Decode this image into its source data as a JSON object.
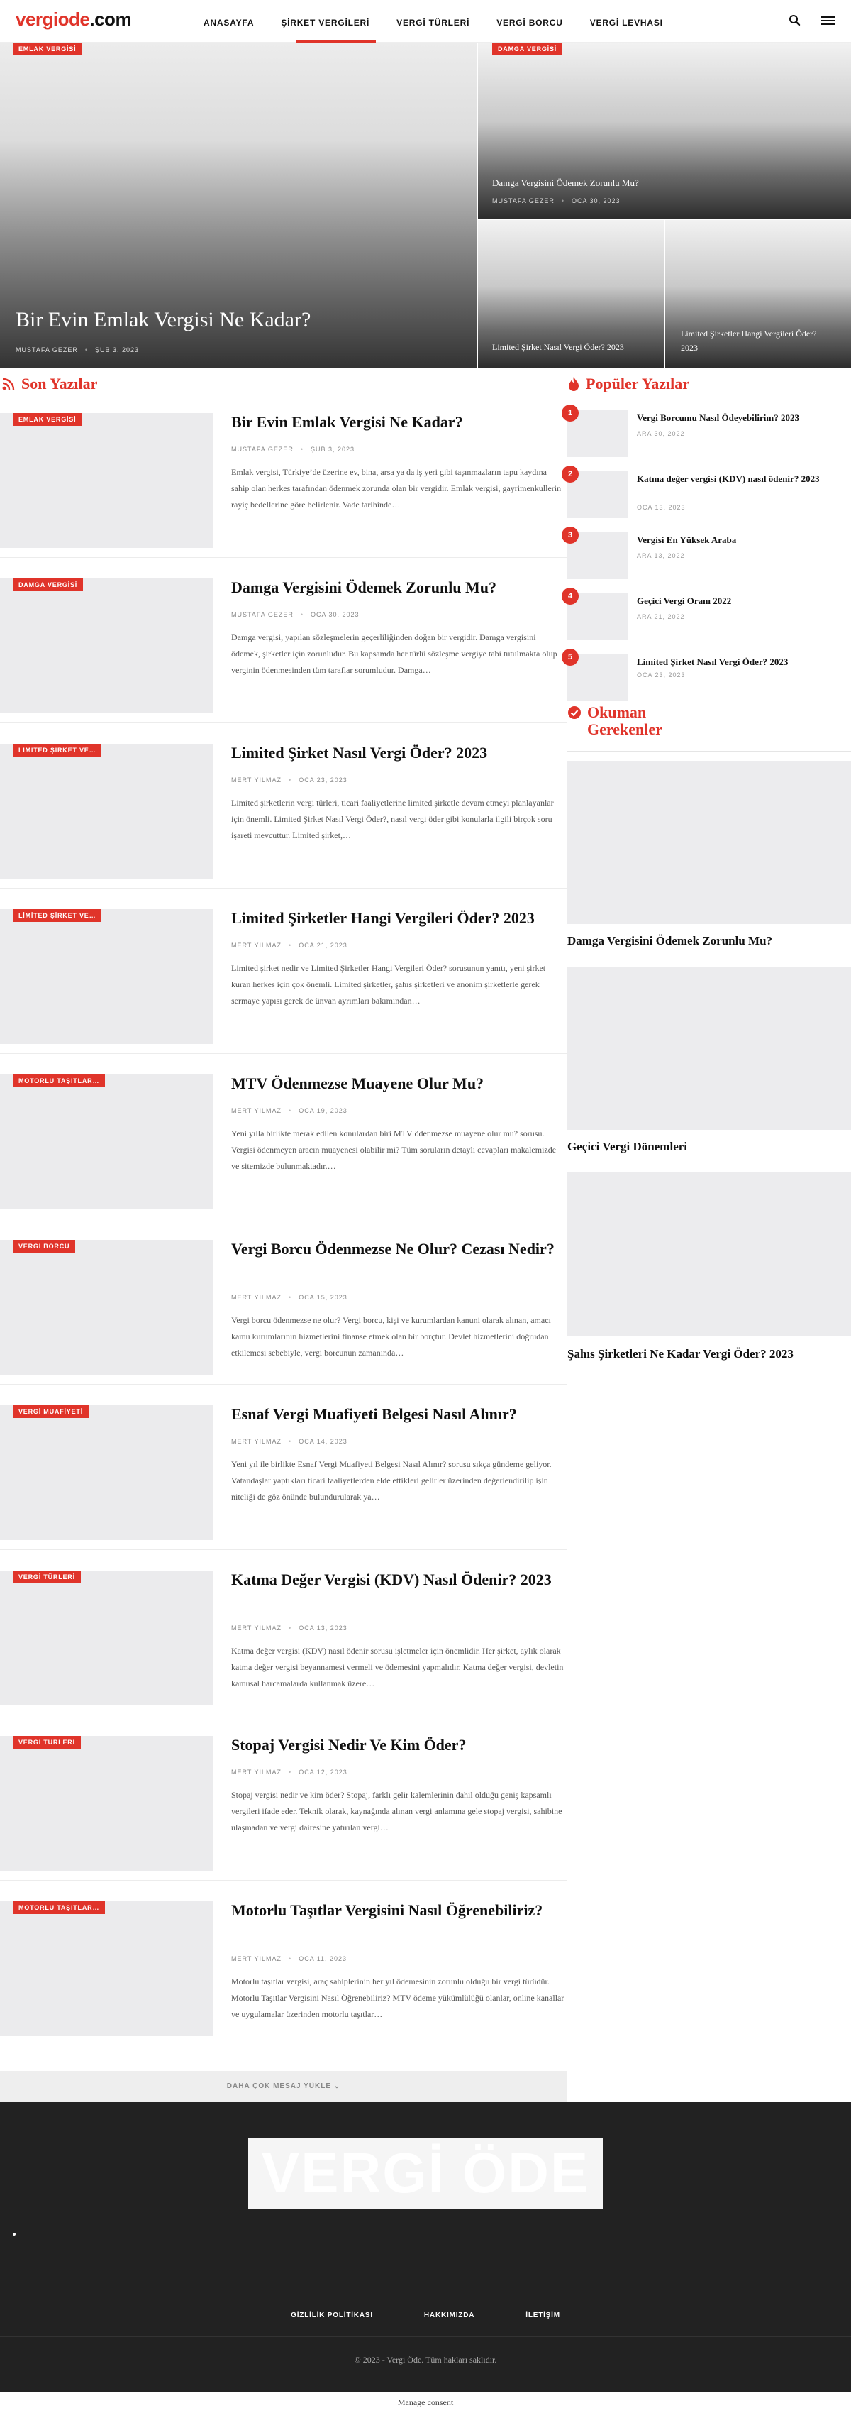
{
  "logo": {
    "part1": "vergiode",
    "part2": ".com"
  },
  "nav": [
    "ANASAYFA",
    "ŞİRKET VERGİLERİ",
    "VERGİ TÜRLERİ",
    "VERGİ BORCU",
    "VERGİ LEVHASI"
  ],
  "hero": {
    "main": {
      "category": "EMLAK VERGİSİ",
      "title": "Bir Evin Emlak Vergisi Ne Kadar?",
      "author": "MUSTAFA GEZER",
      "date": "ŞUB 3, 2023"
    },
    "top_right": {
      "category": "DAMGA VERGİSİ",
      "title": "Damga Vergisini Ödemek Zorunlu Mu?",
      "author": "MUSTAFA GEZER",
      "date": "OCA 30, 2023"
    },
    "bottom_left": {
      "title": "Limited Şirket Nasıl Vergi Öder? 2023"
    },
    "bottom_right": {
      "title": "Limited Şirketler Hangi Vergileri Öder? 2023"
    }
  },
  "latest_heading": "Son Yazılar",
  "articles": [
    {
      "category": "EMLAK VERGİSİ",
      "title": "Bir Evin Emlak Vergisi Ne Kadar?",
      "author": "MUSTAFA GEZER",
      "date": "ŞUB 3, 2023",
      "excerpt": "Emlak vergisi, Türkiye’de üzerine ev, bina, arsa ya da iş yeri gibi taşınmazların tapu kaydına sahip olan herkes tarafından ödenmek zorunda olan bir vergidir. Emlak vergisi, gayrimenkullerin rayiç bedellerine göre belirlenir. Vade tarihinde…"
    },
    {
      "category": "DAMGA VERGİSİ",
      "title": "Damga Vergisini Ödemek Zorunlu Mu?",
      "author": "MUSTAFA GEZER",
      "date": "OCA 30, 2023",
      "excerpt": "Damga vergisi, yapılan sözleşmelerin geçerliliğinden doğan bir vergidir. Damga vergisini ödemek, şirketler için zorunludur. Bu kapsamda her türlü sözleşme vergiye tabi tutulmakta olup verginin ödenmesinden tüm taraflar sorumludur. Damga…"
    },
    {
      "category": "LİMİTED ŞİRKET VE…",
      "title": "Limited Şirket Nasıl Vergi Öder? 2023",
      "author": "MERT YILMAZ",
      "date": "OCA 23, 2023",
      "excerpt": "Limited şirketlerin vergi türleri, ticari faaliyetlerine limited şirketle devam etmeyi planlayanlar için önemli. Limited Şirket Nasıl Vergi Öder?, nasıl vergi öder gibi konularla ilgili birçok soru işareti mevcuttur. Limited şirket,…"
    },
    {
      "category": "LİMİTED ŞİRKET VE…",
      "title": "Limited Şirketler Hangi Vergileri Öder? 2023",
      "author": "MERT YILMAZ",
      "date": "OCA 21, 2023",
      "excerpt": "Limited şirket nedir ve Limited Şirketler Hangi Vergileri Öder? sorusunun yanıtı, yeni şirket kuran herkes için çok önemli. Limited şirketler, şahıs şirketleri ve anonim şirketlerle gerek sermaye yapısı gerek de ünvan ayrımları bakımından…"
    },
    {
      "category": "MOTORLU TAŞITLAR…",
      "title": "MTV Ödenmezse Muayene Olur Mu?",
      "author": "MERT YILMAZ",
      "date": "OCA 19, 2023",
      "excerpt": "Yeni yılla birlikte merak edilen konulardan biri MTV ödenmezse muayene olur mu? sorusu. Vergisi ödenmeyen aracın muayenesi olabilir mi? Tüm soruların detaylı cevapları makalemizde ve sitemizde bulunmaktadır.…"
    },
    {
      "category": "VERGİ BORCU",
      "title": "Vergi Borcu Ödenmezse Ne Olur? Cezası Nedir?",
      "author": "MERT YILMAZ",
      "date": "OCA 15, 2023",
      "excerpt": "Vergi borcu ödenmezse ne olur? Vergi borcu, kişi ve kurumlardan kanuni olarak alınan, amacı kamu kurumlarının hizmetlerini finanse etmek olan bir borçtur. Devlet hizmetlerini doğrudan etkilemesi sebebiyle, vergi borcunun zamanında…"
    },
    {
      "category": "VERGİ MUAFİYETİ",
      "title": "Esnaf Vergi Muafiyeti Belgesi Nasıl Alınır?",
      "author": "MERT YILMAZ",
      "date": "OCA 14, 2023",
      "excerpt": "Yeni yıl ile birlikte Esnaf Vergi Muafiyeti Belgesi Nasıl Alınır? sorusu sıkça gündeme geliyor. Vatandaşlar yaptıkları ticari faaliyetlerden elde ettikleri gelirler üzerinden değerlendirilip işin niteliği de göz önünde bulundurularak ya…"
    },
    {
      "category": "VERGİ TÜRLERİ",
      "title": "Katma Değer Vergisi (KDV) Nasıl Ödenir? 2023",
      "author": "MERT YILMAZ",
      "date": "OCA 13, 2023",
      "excerpt": "Katma değer vergisi (KDV) nasıl ödenir sorusu işletmeler için önemlidir. Her şirket, aylık olarak katma değer vergisi beyannamesi vermeli ve ödemesini yapmalıdır. Katma değer vergisi, devletin kamusal harcamalarda kullanmak üzere…"
    },
    {
      "category": "VERGİ TÜRLERİ",
      "title": "Stopaj Vergisi Nedir Ve Kim Öder?",
      "author": "MERT YILMAZ",
      "date": "OCA 12, 2023",
      "excerpt": "Stopaj vergisi nedir ve kim öder? Stopaj, farklı gelir kalemlerinin dahil olduğu geniş kapsamlı vergileri ifade eder. Teknik olarak, kaynağında alınan vergi anlamına gele stopaj vergisi, sahibine ulaşmadan ve vergi dairesine yatırılan vergi…"
    },
    {
      "category": "MOTORLU TAŞITLAR…",
      "title": "Motorlu Taşıtlar Vergisini Nasıl Öğrenebiliriz?",
      "author": "MERT YILMAZ",
      "date": "OCA 11, 2023",
      "excerpt": "Motorlu taşıtlar vergisi, araç sahiplerinin her yıl ödemesinin zorunlu olduğu bir vergi türüdür. Motorlu Taşıtlar Vergisini Nasıl Öğrenebiliriz? MTV ödeme yükümlülüğü olanlar, online kanallar ve uygulamalar üzerinden motorlu taşıtlar…"
    }
  ],
  "load_more": "DAHA ÇOK MESAJ YÜKLE ⌄",
  "popular_heading": "Popüler Yazılar",
  "popular": [
    {
      "num": "1",
      "title": "Vergi Borcumu Nasıl Ödeyebilirim? 2023",
      "date": "ARA 30, 2022"
    },
    {
      "num": "2",
      "title": "Katma değer vergisi (KDV) nasıl ödenir? 2023",
      "date": "OCA 13, 2023"
    },
    {
      "num": "3",
      "title": "Vergisi En Yüksek Araba",
      "date": "ARA 13, 2022"
    },
    {
      "num": "4",
      "title": "Geçici Vergi Oranı 2022",
      "date": "ARA 21, 2022"
    },
    {
      "num": "5",
      "title": "Limited Şirket Nasıl Vergi Öder? 2023",
      "date": "OCA 23, 2023"
    }
  ],
  "must_read_heading": {
    "line1": "Okuman",
    "line2": "Gerekenler"
  },
  "must_read": [
    {
      "title": "Damga Vergisini Ödemek Zorunlu Mu?"
    },
    {
      "title": "Geçici Vergi Dönemleri"
    },
    {
      "title": "Şahıs Şirketleri Ne Kadar Vergi Öder? 2023"
    }
  ],
  "footer": {
    "logo_text": "VERGİ ÖDE",
    "links": [
      "GİZLİLİK POLİTİKASI",
      "HAKKIMIZDA",
      "İLETİŞİM"
    ],
    "copyright": "© 2023 - Vergi Öde. Tüm hakları saklıdır."
  },
  "manage_consent": "Manage consent",
  "colors": {
    "accent": "#e0342a",
    "footer_bg": "#222222",
    "thumb_placeholder": "#ebebed"
  }
}
